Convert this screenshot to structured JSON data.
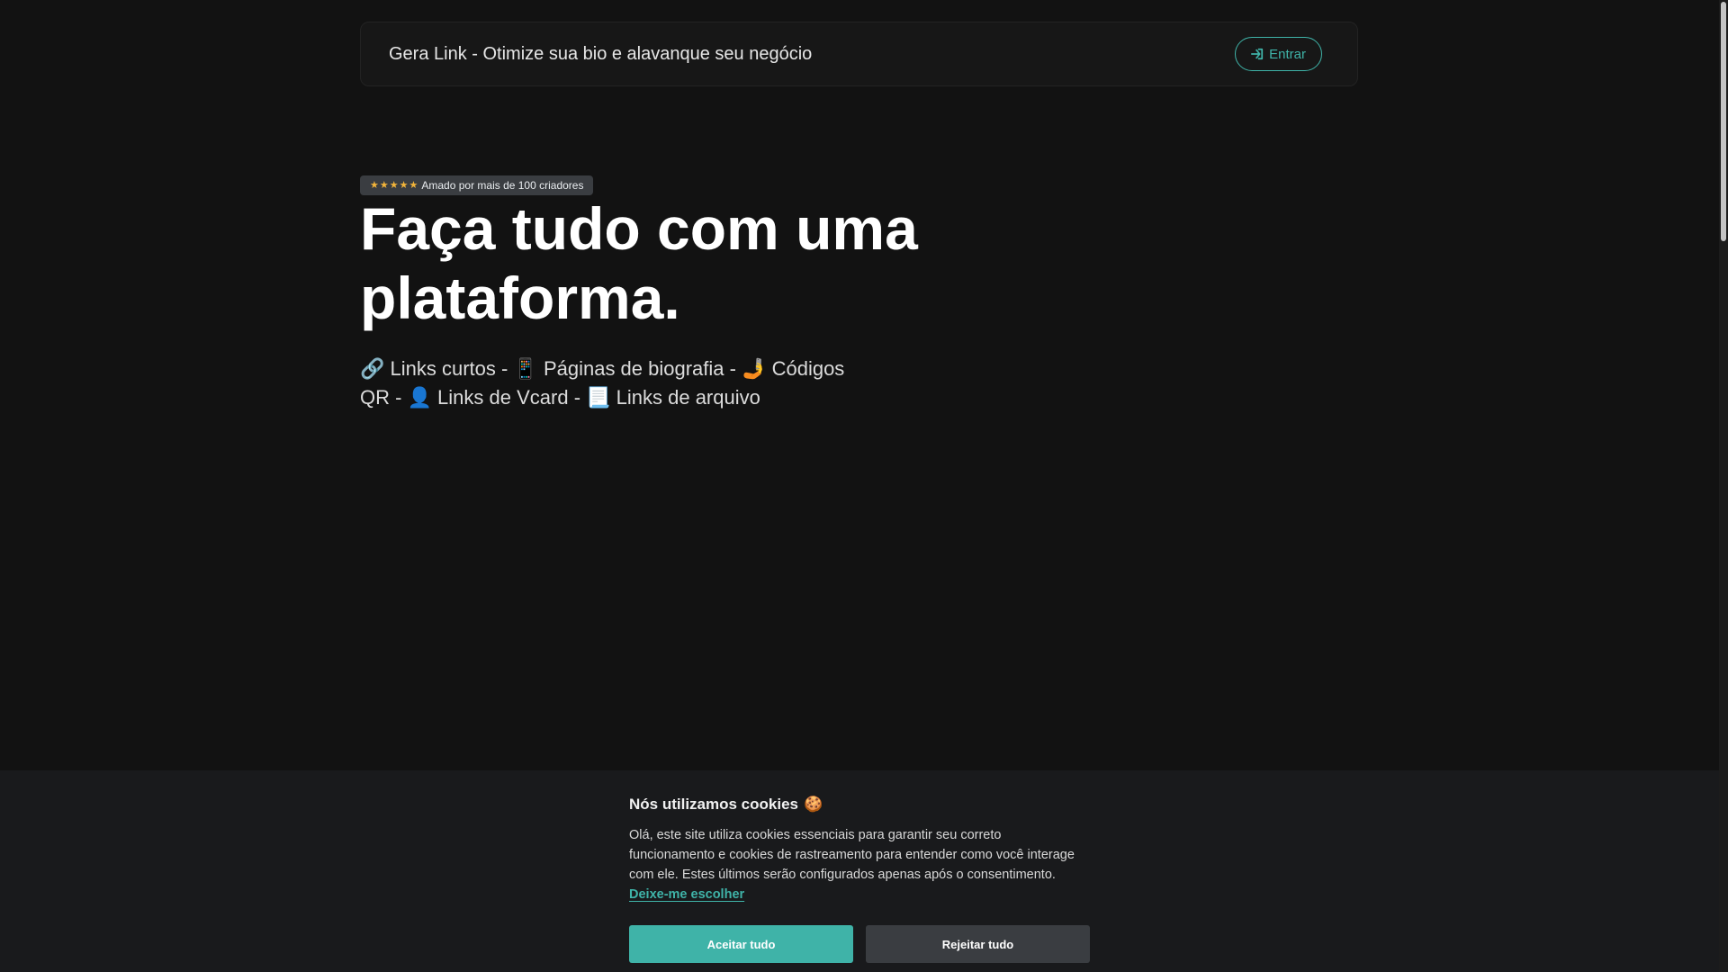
{
  "navbar": {
    "brand": "Gera Link - Otimize sua bio e alavanque seu negócio",
    "login_label": "Entrar"
  },
  "hero": {
    "badge_text": "Amado por mais de 100 criadores",
    "rating_stars": 5,
    "title": "Faça tudo com uma plataforma.",
    "subtitle": "🔗 Links curtos - 📱 Páginas de biografia - 🤳 Códigos QR - 👤 Links de Vcard - 📃 Links de arquivo"
  },
  "cookie": {
    "title": "Nós utilizamos cookies",
    "title_emoji": "🍪",
    "text": "Olá, este site utiliza cookies essenciais para garantir seu correto funcionamento e cookies de rastreamento para entender como você interage com ele. Estes últimos serão configurados apenas após o consentimento.",
    "choose_link": "Deixe-me escolher",
    "accept_label": "Aceitar tudo",
    "reject_label": "Rejeitar tudo"
  },
  "colors": {
    "background": "#121212",
    "accent": "#3fb3a8",
    "star": "#f2b43a",
    "badge_bg": "#3a3d41"
  },
  "icons": {
    "login": "sign-in-icon",
    "star": "star-icon"
  }
}
